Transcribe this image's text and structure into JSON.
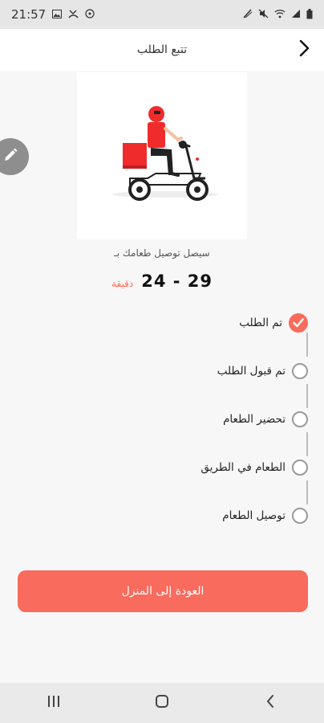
{
  "status_bar": {
    "time": "21:57",
    "left_icons": [
      "gallery-icon",
      "missed-call-icon",
      "whatsapp-icon"
    ],
    "right_icons": [
      "data-saver-icon",
      "mute-icon",
      "wifi-icon",
      "signal-icon",
      "battery-icon"
    ]
  },
  "header": {
    "title": "تتبع الطلب",
    "back_icon": "chevron-right-icon"
  },
  "hero": {
    "illustration": "delivery-scooter-illustration",
    "edit_icon": "pencil-icon"
  },
  "eta": {
    "label": "سيصل توصيل طعامك بـ",
    "value": "24 - 29",
    "unit": "دقيقة"
  },
  "timeline": {
    "steps": [
      {
        "label": "تم الطلب",
        "done": true
      },
      {
        "label": "تم قبول الطلب",
        "done": false
      },
      {
        "label": "تحضير الطعام",
        "done": false
      },
      {
        "label": "الطعام في الطريق",
        "done": false
      },
      {
        "label": "توصيل الطعام",
        "done": false
      }
    ]
  },
  "home_button": {
    "label": "العودة إلى المنزل"
  },
  "nav_bar": {
    "icons": [
      "recent-apps-icon",
      "home-icon",
      "back-icon"
    ]
  },
  "colors": {
    "accent": "#f86b5d",
    "check": "#fa6a5c",
    "eta_unit": "#ff6a5a",
    "illustration_red": "#ef2b2b"
  }
}
